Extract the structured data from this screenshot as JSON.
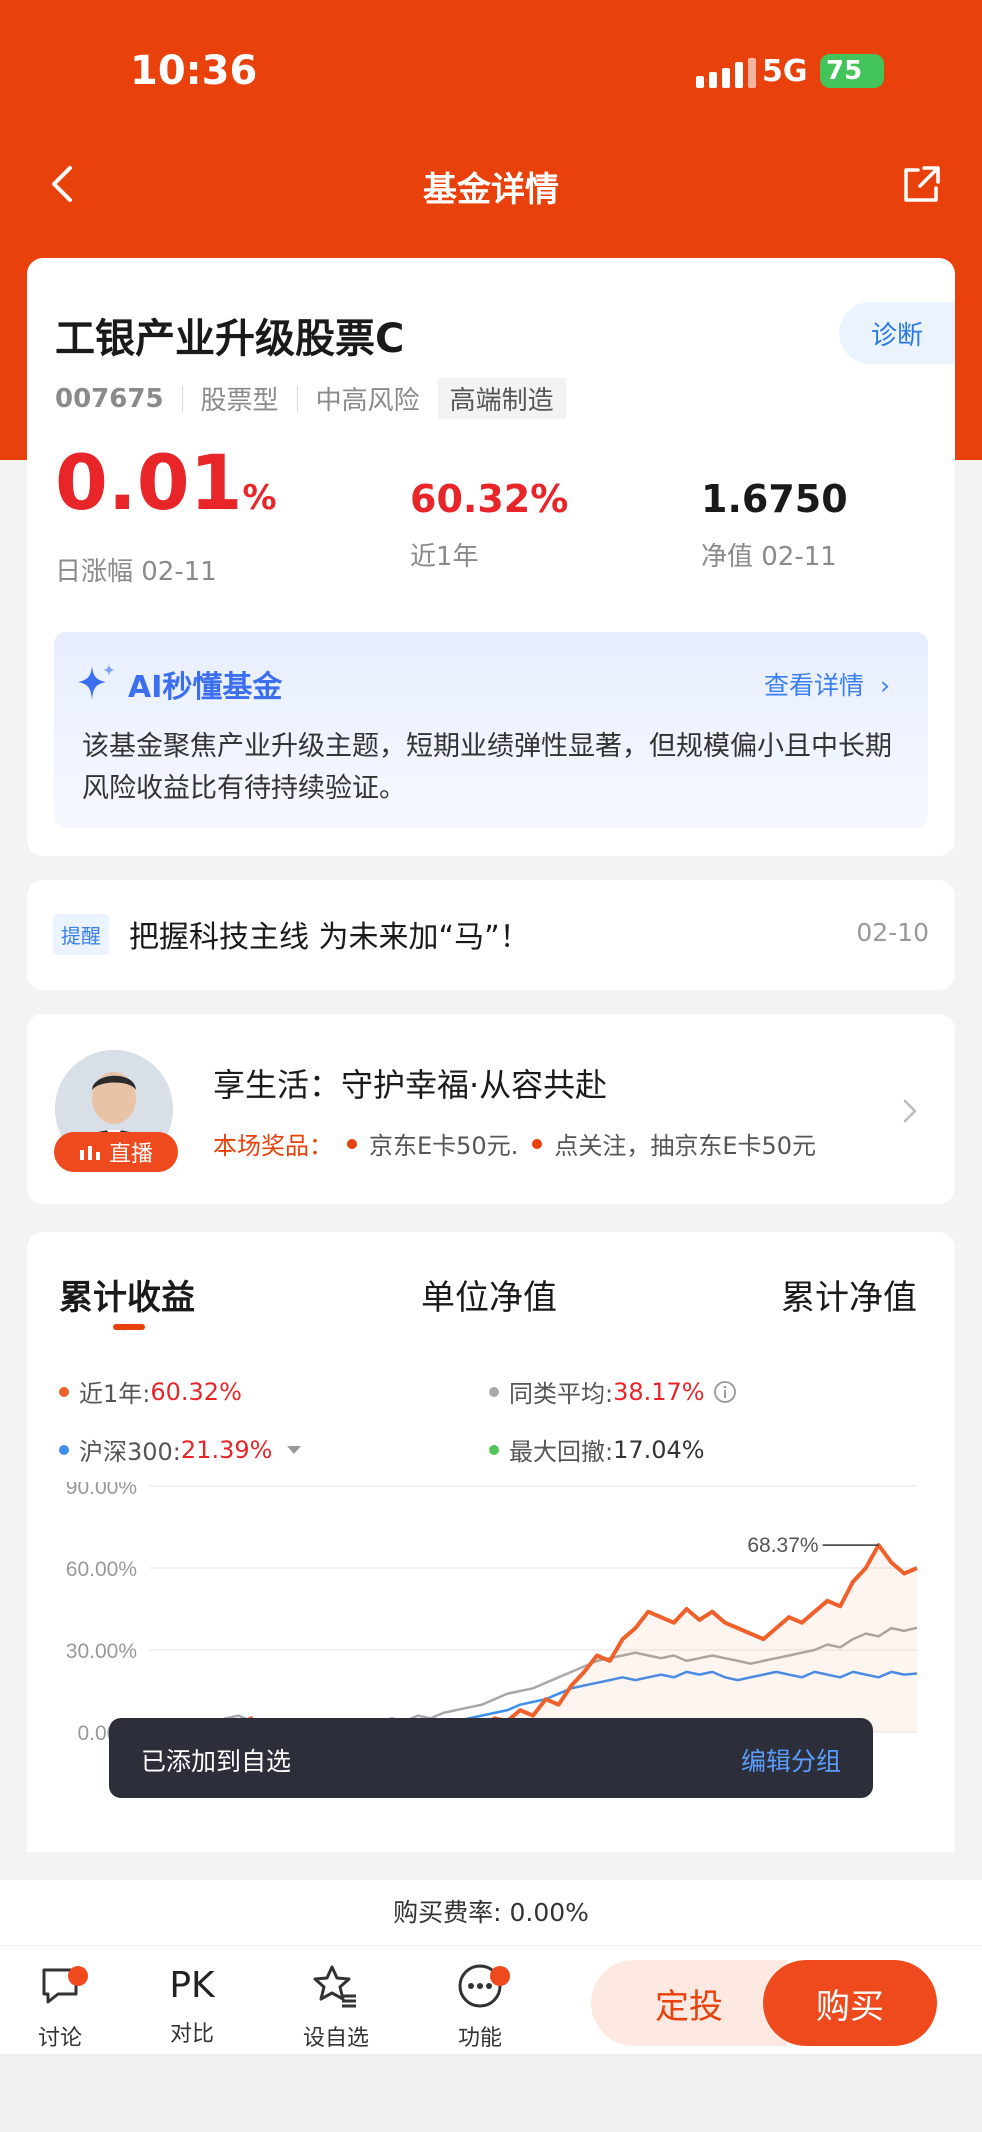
{
  "status_bar": {
    "time": "10:36",
    "network": "5G",
    "battery": "75"
  },
  "nav": {
    "title": "基金详情"
  },
  "fund": {
    "name": "工银产业升级股票C",
    "diagnose_label": "诊断",
    "code": "007675",
    "type": "股票型",
    "risk": "中高风险",
    "theme": "高端制造",
    "daily_change": "0.01",
    "daily_change_unit": "%",
    "daily_change_label": "日涨幅 02-11",
    "year_return": "60.32%",
    "year_return_label": "近1年",
    "nav_value": "1.6750",
    "nav_label": "净值 02-11"
  },
  "ai_summary": {
    "title": "AI秒懂基金",
    "more_label": "查看详情",
    "text": "该基金聚焦产业升级主题，短期业绩弹性显著，但规模偏小且中长期风险收益比有待持续验证。"
  },
  "reminder": {
    "tag": "提醒",
    "text": "把握科技主线 为未来加“马”！",
    "date": "02-10"
  },
  "live": {
    "badge": "直播",
    "title": "享生活：守护幸福·从容共赴",
    "prize_label": "本场奖品：",
    "prize_1": "京东E卡50元.",
    "prize_2": "点关注，抽京东E卡50元"
  },
  "chart_tabs": [
    "累计收益",
    "单位净值",
    "累计净值"
  ],
  "legend": {
    "fund_label": "近1年:",
    "fund_value": "60.32%",
    "peer_label": "同类平均:",
    "peer_value": "38.17%",
    "index_label": "沪深300:",
    "index_value": "21.39%",
    "drawdown_label": "最大回撤:",
    "drawdown_value": "17.04%"
  },
  "colors": {
    "fund": "#f0602a",
    "peer": "#a8a8a8",
    "index": "#3f8ff0",
    "drawdown": "#52c45a",
    "brand": "#e8410b"
  },
  "chart_data": {
    "type": "line",
    "yticks": [
      "90.00%",
      "60.00%",
      "30.00%",
      "0.00%"
    ],
    "ylim": [
      0,
      90
    ],
    "peak_annotation": "68.37%",
    "series": [
      {
        "name": "近1年",
        "values": [
          0,
          2,
          -1,
          3,
          1,
          4,
          2,
          3,
          5,
          -10,
          -8,
          -6,
          -9,
          -7,
          -5,
          -6,
          -4,
          -5,
          -3,
          0,
          -2,
          1,
          -1,
          2,
          0,
          3,
          2,
          5,
          4,
          8,
          6,
          12,
          10,
          17,
          22,
          28,
          26,
          34,
          38,
          44,
          42,
          40,
          45,
          41,
          44,
          40,
          38,
          36,
          34,
          38,
          42,
          40,
          44,
          48,
          46,
          55,
          60,
          68.37,
          62,
          58,
          60
        ]
      },
      {
        "name": "同类平均",
        "values": [
          0,
          2,
          3,
          4,
          2,
          3,
          5,
          6,
          4,
          2,
          1,
          0,
          1,
          2,
          1,
          2,
          3,
          2,
          4,
          5,
          4,
          6,
          5,
          7,
          8,
          9,
          10,
          12,
          14,
          15,
          16,
          18,
          20,
          22,
          24,
          26,
          27,
          28,
          29,
          28,
          27,
          28,
          26,
          27,
          28,
          27,
          26,
          25,
          26,
          27,
          28,
          29,
          30,
          32,
          31,
          34,
          36,
          35,
          38,
          37,
          38.17
        ]
      },
      {
        "name": "沪深300",
        "values": [
          0,
          -1,
          0,
          1,
          -1,
          0,
          1,
          0,
          -1,
          -4,
          -3,
          -2,
          -3,
          -2,
          -1,
          -2,
          -1,
          0,
          -1,
          1,
          0,
          2,
          1,
          3,
          4,
          5,
          6,
          7,
          8,
          10,
          11,
          12,
          14,
          16,
          17,
          18,
          19,
          20,
          19,
          20,
          21,
          20,
          22,
          21,
          22,
          20,
          19,
          20,
          21,
          22,
          21,
          20,
          22,
          21,
          20,
          22,
          21,
          20,
          22,
          21,
          21.39
        ]
      }
    ]
  },
  "toast": {
    "message": "已添加到自选",
    "action": "编辑分组"
  },
  "fee": {
    "text": "购买费率: 0.00%"
  },
  "bottom": {
    "discuss": "讨论",
    "pk_icon": "PK",
    "compare": "对比",
    "watch": "设自选",
    "more": "功能",
    "dingtou": "定投",
    "buy": "购买"
  }
}
